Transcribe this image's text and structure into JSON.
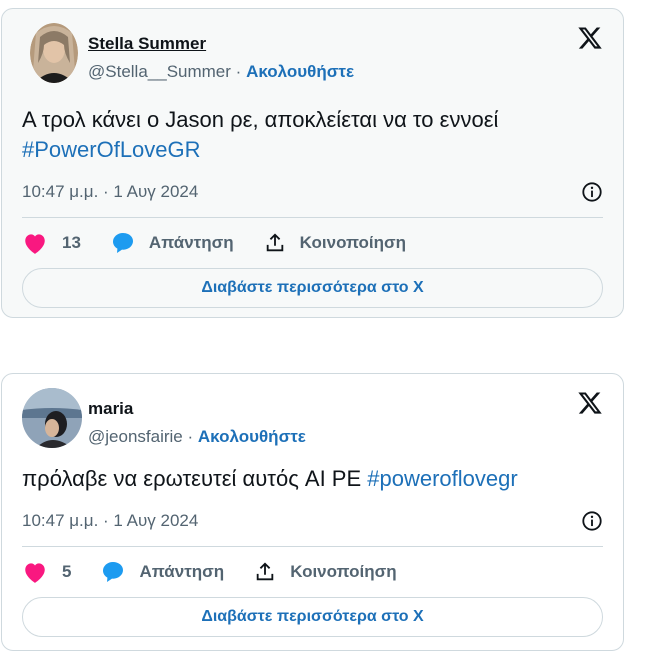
{
  "tweets": [
    {
      "name": "Stella Summer",
      "handle": "@Stella__Summer",
      "separator": "·",
      "follow": "Ακολουθήστε",
      "text": "Α τρολ κάνει ο Jason ρε, αποκλείεται να το εννοεί",
      "hashtag": "#PowerOfLoveGR",
      "timestamp": "10:47 μ.μ. · 1 Αυγ 2024",
      "likes": "13",
      "reply_label": "Απάντηση",
      "share_label": "Κοινοποίηση",
      "read_more": "Διαβάστε περισσότερα στο X"
    },
    {
      "name": "maria",
      "handle": "@jeonsfairie",
      "separator": "·",
      "follow": "Ακολουθήστε",
      "text": "πρόλαβε να ερωτευτεί αυτός AI PE ",
      "hashtag": "#poweroflovegr",
      "timestamp": "10:47 μ.μ. · 1 Αυγ 2024",
      "likes": "5",
      "reply_label": "Απάντηση",
      "share_label": "Κοινοποίηση",
      "read_more": "Διαβάστε περισσότερα στο X"
    }
  ],
  "colors": {
    "link": "#1d70b8",
    "heart": "#f91880",
    "reply": "#1d9bf0",
    "border": "#cfd9de",
    "muted": "#536471"
  },
  "icons": [
    "x-logo-icon",
    "info-icon",
    "heart-icon",
    "reply-bubble-icon",
    "share-icon"
  ]
}
